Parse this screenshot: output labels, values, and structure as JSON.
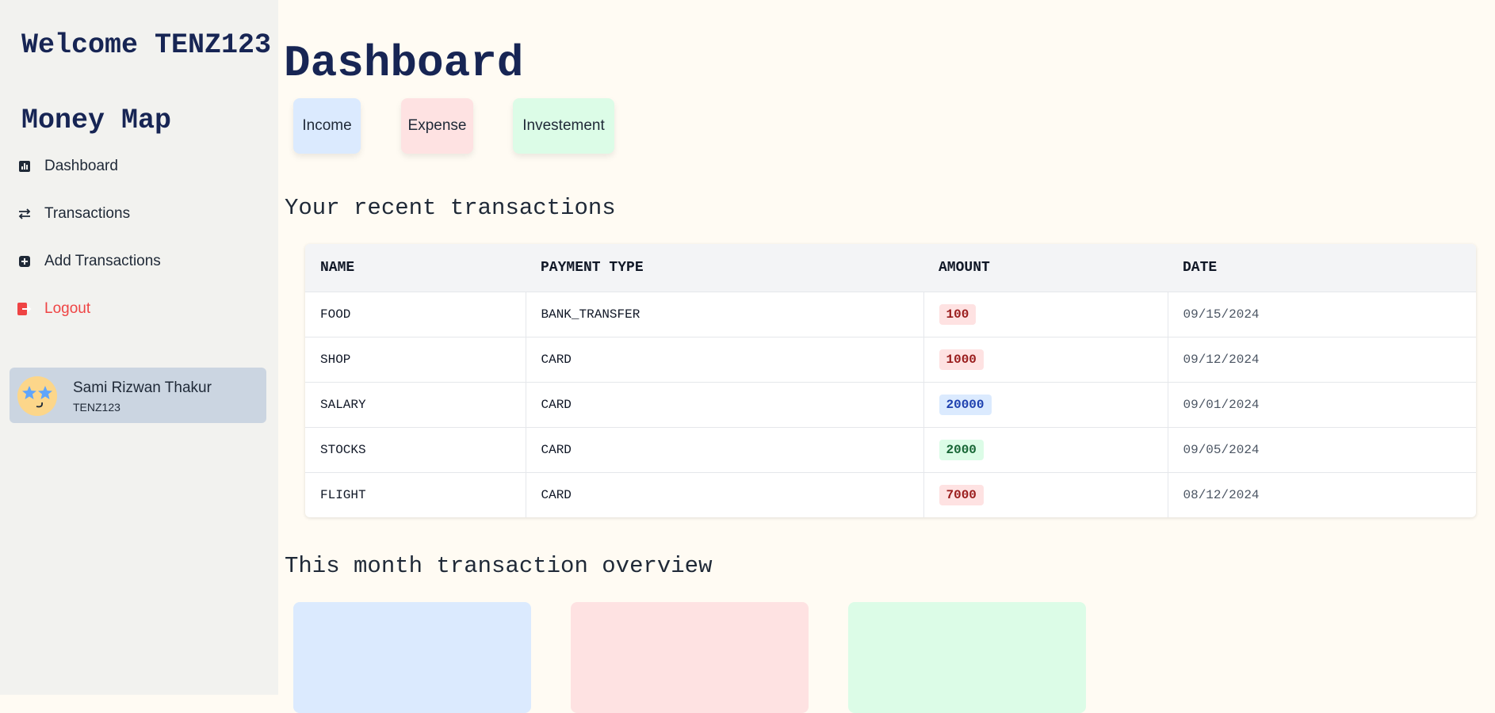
{
  "sidebar": {
    "welcome": "Welcome TENZ123",
    "brand": "Money Map",
    "nav": [
      {
        "label": "Dashboard",
        "icon": "bar-chart-icon"
      },
      {
        "label": "Transactions",
        "icon": "arrows-exchange-icon"
      },
      {
        "label": "Add Transactions",
        "icon": "plus-square-icon"
      },
      {
        "label": "Logout",
        "icon": "logout-icon"
      }
    ],
    "profile": {
      "name": "Sami Rizwan Thakur",
      "username": "TENZ123",
      "avatar": "star-eyes-emoji"
    }
  },
  "main": {
    "title": "Dashboard",
    "chips": [
      {
        "label": "Income",
        "color": "#dbeafe"
      },
      {
        "label": "Expense",
        "color": "#fee2e2"
      },
      {
        "label": "Investement",
        "color": "#dcfce7"
      }
    ],
    "recent_title": "Your recent transactions",
    "table": {
      "headers": [
        "NAME",
        "PAYMENT TYPE",
        "AMOUNT",
        "DATE"
      ],
      "rows": [
        {
          "name": "FOOD",
          "type": "BANK_TRANSFER",
          "amount": "100",
          "kind": "expense",
          "date": "09/15/2024"
        },
        {
          "name": "SHOP",
          "type": "CARD",
          "amount": "1000",
          "kind": "expense",
          "date": "09/12/2024"
        },
        {
          "name": "SALARY",
          "type": "CARD",
          "amount": "20000",
          "kind": "income",
          "date": "09/01/2024"
        },
        {
          "name": "STOCKS",
          "type": "CARD",
          "amount": "2000",
          "kind": "investment",
          "date": "09/05/2024"
        },
        {
          "name": "FLIGHT",
          "type": "CARD",
          "amount": "7000",
          "kind": "expense",
          "date": "08/12/2024"
        }
      ]
    },
    "overview_title": "This month transaction overview",
    "overview_cards": [
      {
        "color": "#dbeafe"
      },
      {
        "color": "#fee2e2"
      },
      {
        "color": "#dcfce7"
      }
    ]
  }
}
